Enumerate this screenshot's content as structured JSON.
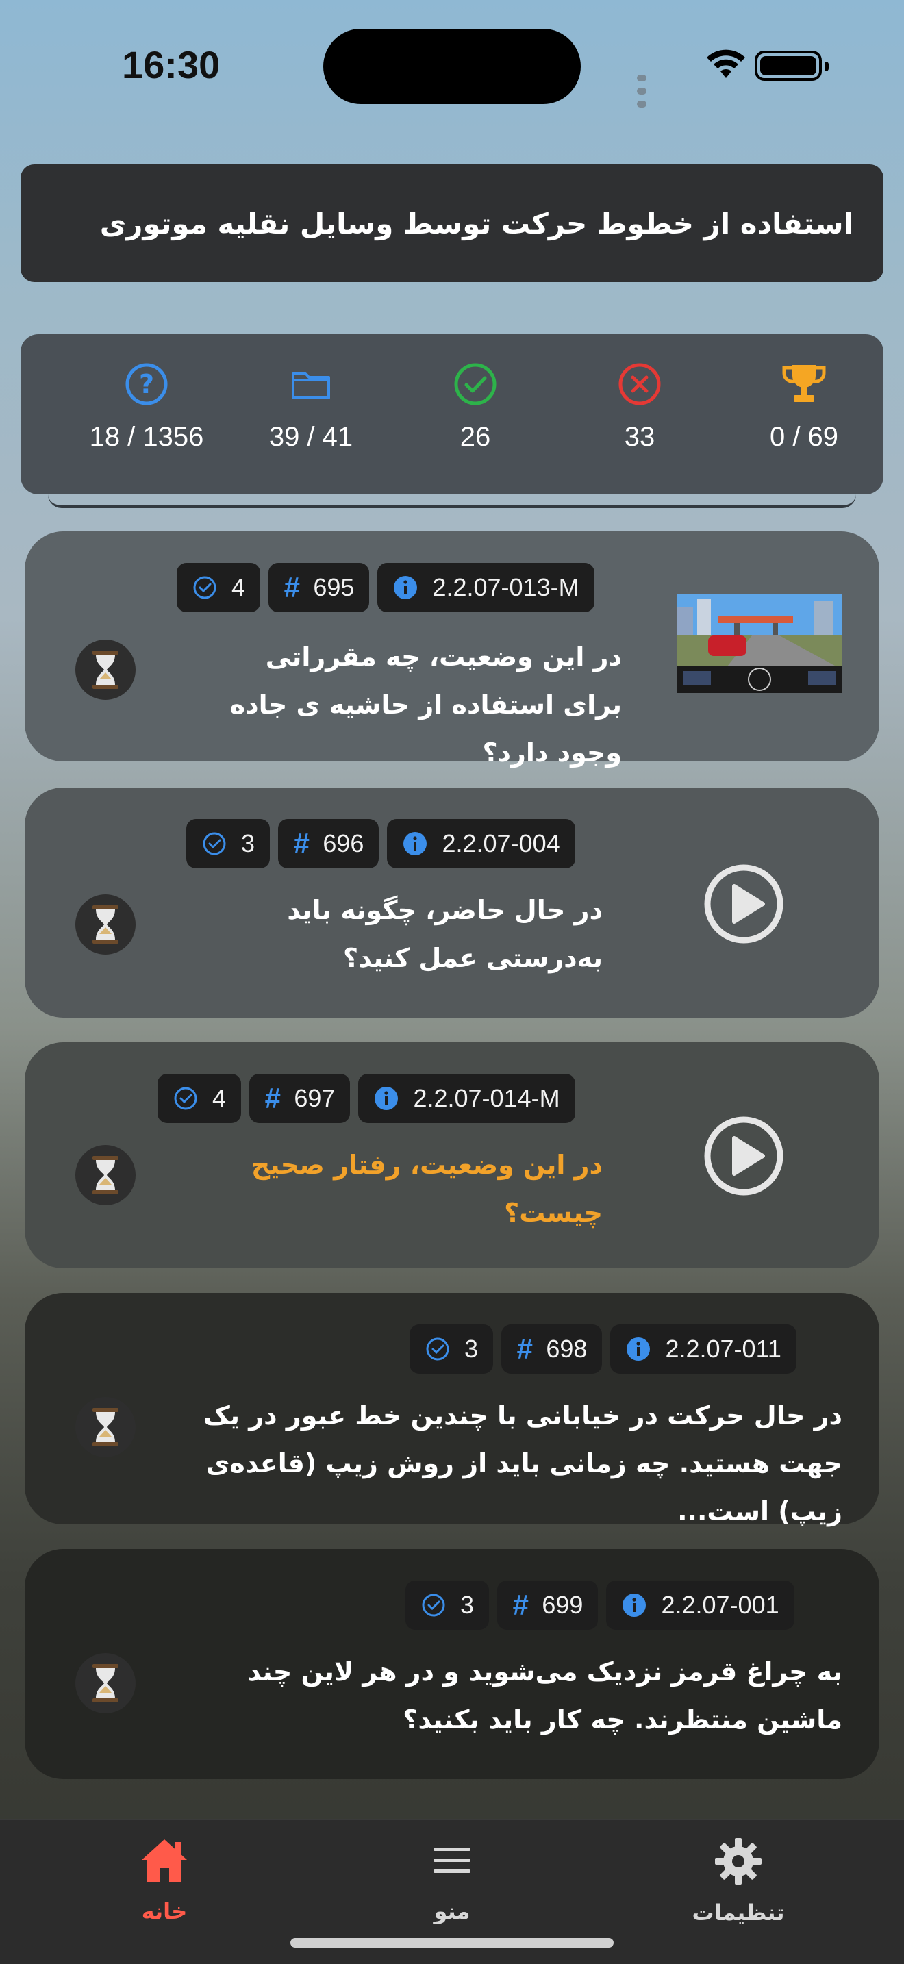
{
  "status": {
    "time": "16:30"
  },
  "header": {
    "title": "استفاده از خطوط حرکت توسط وسایل نقلیه موتوری"
  },
  "stats": {
    "questions": "18 / 1356",
    "folders": "39 / 41",
    "correct": "26",
    "wrong": "33",
    "trophy": "0 / 69"
  },
  "colors": {
    "accent": "#ff5a4a",
    "blue": "#3b8eea",
    "green": "#2db34a",
    "red": "#e53935",
    "gold": "#f5a623",
    "orange_text": "#f2a22a"
  },
  "cards": [
    {
      "checks": "4",
      "number": "695",
      "code": "2.2.07-013-M",
      "text": "در این وضعیت، چه مقرراتی برای استفاده از حاشیه ی جاده وجود دارد؟",
      "media": "image"
    },
    {
      "checks": "3",
      "number": "696",
      "code": "2.2.07-004",
      "text": "در حال حاضر، چگونه باید به‌درستی عمل کنید؟",
      "media": "video"
    },
    {
      "checks": "4",
      "number": "697",
      "code": "2.2.07-014-M",
      "text": "در این وضعیت، رفتار صحیح چیست؟",
      "media": "video"
    },
    {
      "checks": "3",
      "number": "698",
      "code": "2.2.07-011",
      "text": "در حال حرکت در خیابانی با چندین خط عبور در یک جهت هستید. چه زمانی باید از روش زیپ (قاعده‌ی زیپ) است...",
      "media": "none"
    },
    {
      "checks": "3",
      "number": "699",
      "code": "2.2.07-001",
      "text": "به چراغ قرمز نزدیک می‌شوید و در هر لاین چند ماشین منتظرند. چه کار باید بکنید؟",
      "media": "none"
    }
  ],
  "tabs": {
    "home": "خانه",
    "menu": "منو",
    "settings": "تنظیمات"
  }
}
